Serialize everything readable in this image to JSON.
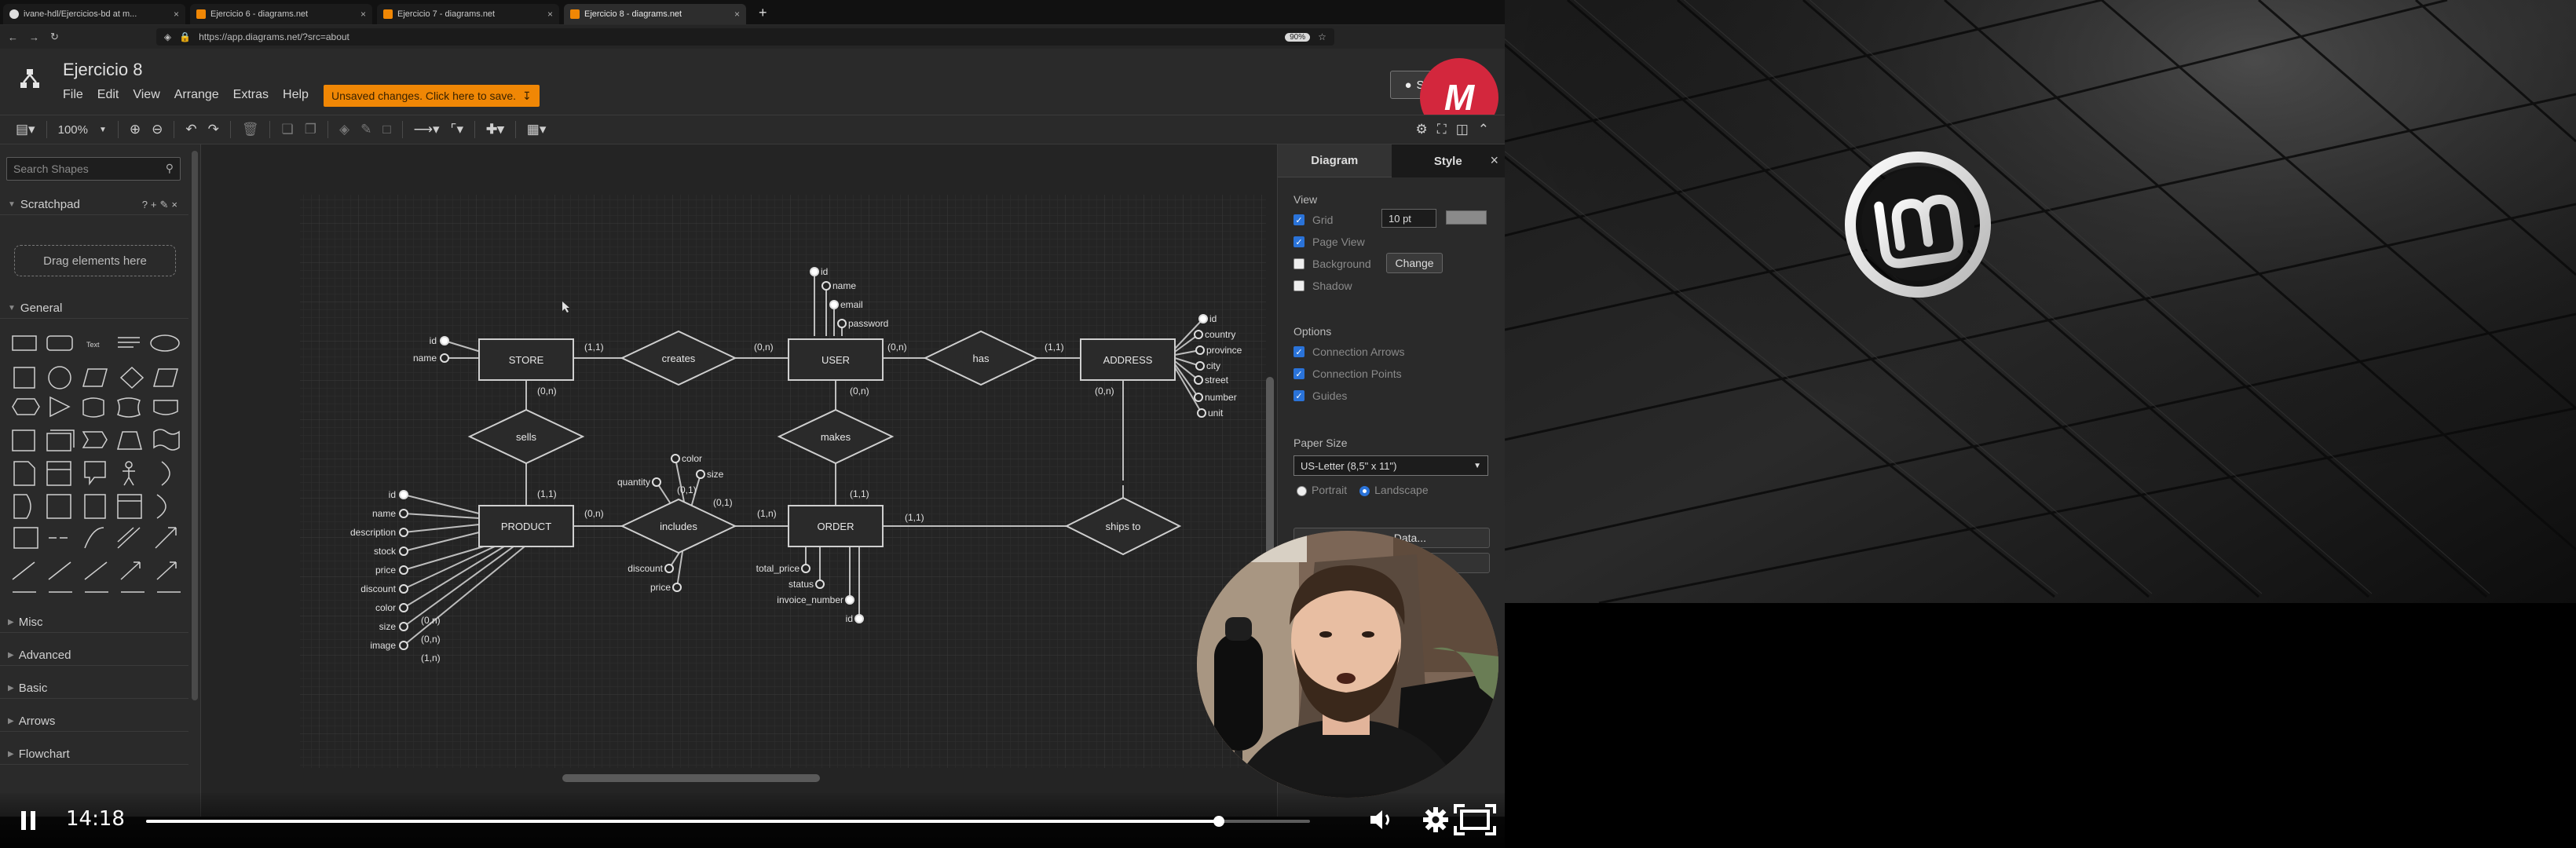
{
  "browser": {
    "tabs": [
      {
        "label": "ivane-hdl/Ejercicios-bd at m...",
        "favicon": "github-icon"
      },
      {
        "label": "Ejercicio 6 - diagrams.net",
        "favicon": "drawio-icon"
      },
      {
        "label": "Ejercicio 7 - diagrams.net",
        "favicon": "drawio-icon"
      },
      {
        "label": "Ejercicio 8 - diagrams.net",
        "favicon": "drawio-icon",
        "active": true
      }
    ],
    "close_glyph": "×",
    "new_tab_glyph": "+",
    "url": "https://app.diagrams.net/?src=about",
    "zoom_badge": "90%"
  },
  "app": {
    "title": "Ejercicio 8",
    "menu": [
      "File",
      "Edit",
      "View",
      "Arrange",
      "Extras",
      "Help"
    ],
    "unsaved_notice": "Unsaved changes. Click here to save.",
    "share_label": "Share",
    "zoom": "100%",
    "channel_logo_text": "M"
  },
  "shapes_panel": {
    "search_placeholder": "Search Shapes",
    "scratchpad": "Scratchpad",
    "drag_hint": "Drag elements here",
    "general": "General",
    "text_shape_label": "Text",
    "sections": [
      "Misc",
      "Advanced",
      "Basic",
      "Arrows",
      "Flowchart"
    ]
  },
  "format_panel": {
    "tabs": [
      "Diagram",
      "Style"
    ],
    "view_title": "View",
    "grid_label": "Grid",
    "grid_size": "10 pt",
    "page_view_label": "Page View",
    "background_label": "Background",
    "change_label": "Change",
    "shadow_label": "Shadow",
    "options_title": "Options",
    "connection_arrows": "Connection Arrows",
    "connection_points": "Connection Points",
    "guides": "Guides",
    "paper_size_title": "Paper Size",
    "paper_size": "US-Letter (8,5\" x 11\")",
    "portrait": "Portrait",
    "landscape": "Landscape",
    "edit_data_partial": "...Data...",
    "partial_button_2": "...de"
  },
  "diagram": {
    "entities": {
      "store": "STORE",
      "user": "USER",
      "address": "ADDRESS",
      "product": "PRODUCT",
      "order": "ORDER"
    },
    "relations": {
      "creates": "creates",
      "has": "has",
      "sells": "sells",
      "makes": "makes",
      "includes": "includes",
      "ships_to": "ships to"
    },
    "store_attrs": [
      "id",
      "name"
    ],
    "user_attrs": [
      "id",
      "name",
      "email",
      "password"
    ],
    "address_attrs": [
      "id",
      "country",
      "province",
      "city",
      "street",
      "number",
      "unit"
    ],
    "product_attrs": [
      "id",
      "name",
      "description",
      "stock",
      "price",
      "discount",
      "color",
      "size",
      "image"
    ],
    "includes_attrs": {
      "quantity": "quantity",
      "color": "color",
      "size": "size",
      "discount": "discount",
      "price": "price"
    },
    "order_attrs": [
      "total_price",
      "status",
      "invoice_number",
      "id"
    ],
    "cardinalities": {
      "store_creates": "(1,1)",
      "creates_user": "(0,n)",
      "user_has": "(0,n)",
      "has_address": "(1,1)",
      "store_sells": "(0,n)",
      "user_makes": "(0,n)",
      "address_ships": "(0,n)",
      "sells_product": "(1,1)",
      "product_includes": "(0,n)",
      "includes_order": "(1,n)",
      "makes_order": "(1,1)",
      "order_ships": "(1,1)",
      "color_sub": "(0,1)",
      "size_sub": "(0,1)",
      "product_color": "(0,n)",
      "product_size": "(0,n)",
      "product_image": "(1,n)"
    }
  },
  "player": {
    "time": "14:18",
    "progress": 0.922
  },
  "colors": {
    "accent": "#2a73d9",
    "unsaved_bg": "#f08705",
    "channel_red": "#d3273d"
  }
}
